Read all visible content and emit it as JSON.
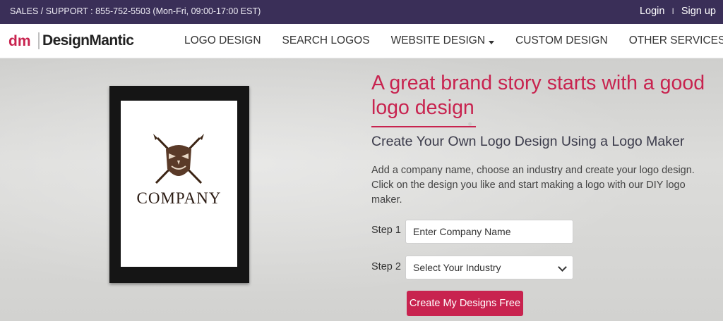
{
  "topbar": {
    "support_text": "SALES / SUPPORT : 855-752-5503 (Mon-Fri, 09:00-17:00 EST)",
    "login_label": "Login",
    "separator": "I",
    "signup_label": "Sign up"
  },
  "brand": {
    "mark_text": "dm",
    "wordmark": "DesignMantic"
  },
  "nav": {
    "items": [
      {
        "label": "LOGO DESIGN",
        "has_dropdown": false
      },
      {
        "label": "SEARCH LOGOS",
        "has_dropdown": false
      },
      {
        "label": "WEBSITE DESIGN",
        "has_dropdown": true
      },
      {
        "label": "CUSTOM DESIGN",
        "has_dropdown": false
      },
      {
        "label": "OTHER SERVICES",
        "has_dropdown": true
      }
    ]
  },
  "hero": {
    "headline": "A great brand story starts with a good logo design",
    "subheadline": "Create Your Own Logo Design Using a Logo Maker",
    "description": "Add a company name, choose an industry and create your logo design. Click on the design you like and start making a logo with our DIY logo maker.",
    "preview_company": "COMPANY",
    "step1_label": "Step 1",
    "step1_placeholder": "Enter Company Name",
    "step2_label": "Step 2",
    "step2_selected": "Select Your Industry",
    "cta_label": "Create My Designs Free"
  },
  "colors": {
    "accent": "#c8234f",
    "topbar": "#3a2f58"
  }
}
